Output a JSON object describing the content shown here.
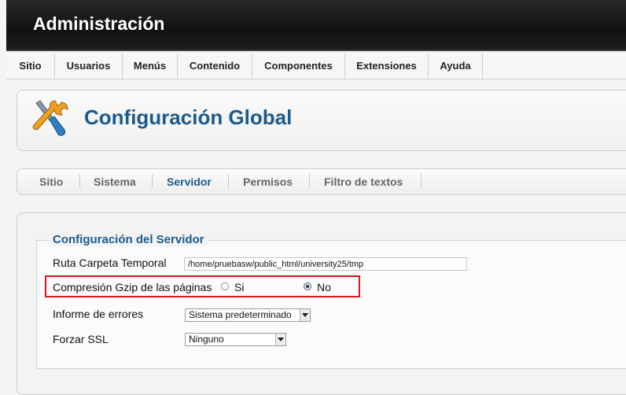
{
  "header": {
    "title": "Administración"
  },
  "menu": [
    "Sitio",
    "Usuarios",
    "Menús",
    "Contenido",
    "Componentes",
    "Extensiones",
    "Ayuda"
  ],
  "page": {
    "title": "Configuración Global",
    "icon": "tools-icon"
  },
  "tabs": [
    {
      "label": "Sitio",
      "active": false
    },
    {
      "label": "Sistema",
      "active": false
    },
    {
      "label": "Servidor",
      "active": true
    },
    {
      "label": "Permisos",
      "active": false
    },
    {
      "label": "Filtro de textos",
      "active": false
    }
  ],
  "server": {
    "legend": "Configuración del Servidor",
    "temp_path_label": "Ruta Carpeta Temporal",
    "temp_path_value": "/home/pruebasw/public_html/university25/tmp",
    "gzip_label": "Compresión Gzip de las páginas",
    "gzip_yes": "Si",
    "gzip_no": "No",
    "gzip_selected": "No",
    "errors_label": "Informe de errores",
    "errors_value": "Sistema predeterminado",
    "ssl_label": "Forzar SSL",
    "ssl_value": "Ninguno"
  },
  "colors": {
    "accent": "#1b5a8c",
    "highlight": "#e0141e"
  }
}
